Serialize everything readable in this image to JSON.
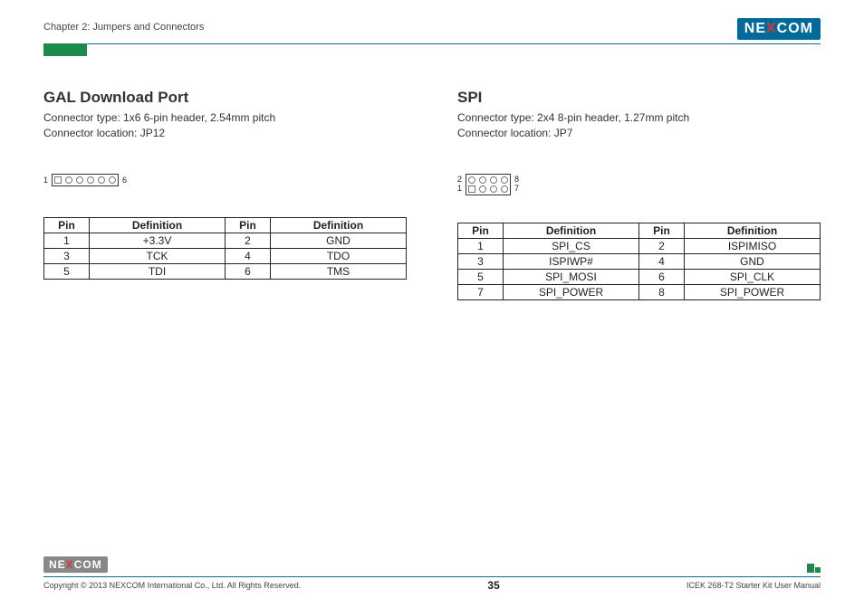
{
  "header": {
    "chapter": "Chapter 2: Jumpers and Connectors",
    "brand_pre": "NE",
    "brand_x": "X",
    "brand_post": "COM"
  },
  "left": {
    "title": "GAL Download Port",
    "conn_type": "Connector type: 1x6 6-pin header, 2.54mm pitch",
    "conn_loc": "Connector location: JP12",
    "diag_left": "1",
    "diag_right": "6",
    "th_pin": "Pin",
    "th_def": "Definition",
    "rows": [
      {
        "p1": "1",
        "d1": "+3.3V",
        "p2": "2",
        "d2": "GND"
      },
      {
        "p1": "3",
        "d1": "TCK",
        "p2": "4",
        "d2": "TDO"
      },
      {
        "p1": "5",
        "d1": "TDI",
        "p2": "6",
        "d2": "TMS"
      }
    ]
  },
  "right": {
    "title": "SPI",
    "conn_type": "Connector type: 2x4 8-pin header, 1.27mm pitch",
    "conn_loc": "Connector location: JP7",
    "diag_tl": "2",
    "diag_tr": "8",
    "diag_bl": "1",
    "diag_br": "7",
    "th_pin": "Pin",
    "th_def": "Definition",
    "rows": [
      {
        "p1": "1",
        "d1": "SPI_CS",
        "p2": "2",
        "d2": "ISPIMISO"
      },
      {
        "p1": "3",
        "d1": "ISPIWP#",
        "p2": "4",
        "d2": "GND"
      },
      {
        "p1": "5",
        "d1": "SPI_MOSI",
        "p2": "6",
        "d2": "SPI_CLK"
      },
      {
        "p1": "7",
        "d1": "SPI_POWER",
        "p2": "8",
        "d2": "SPI_POWER"
      }
    ]
  },
  "footer": {
    "copyright": "Copyright © 2013 NEXCOM International Co., Ltd. All Rights Reserved.",
    "page": "35",
    "doc": "ICEK 268-T2 Starter Kit User Manual"
  }
}
